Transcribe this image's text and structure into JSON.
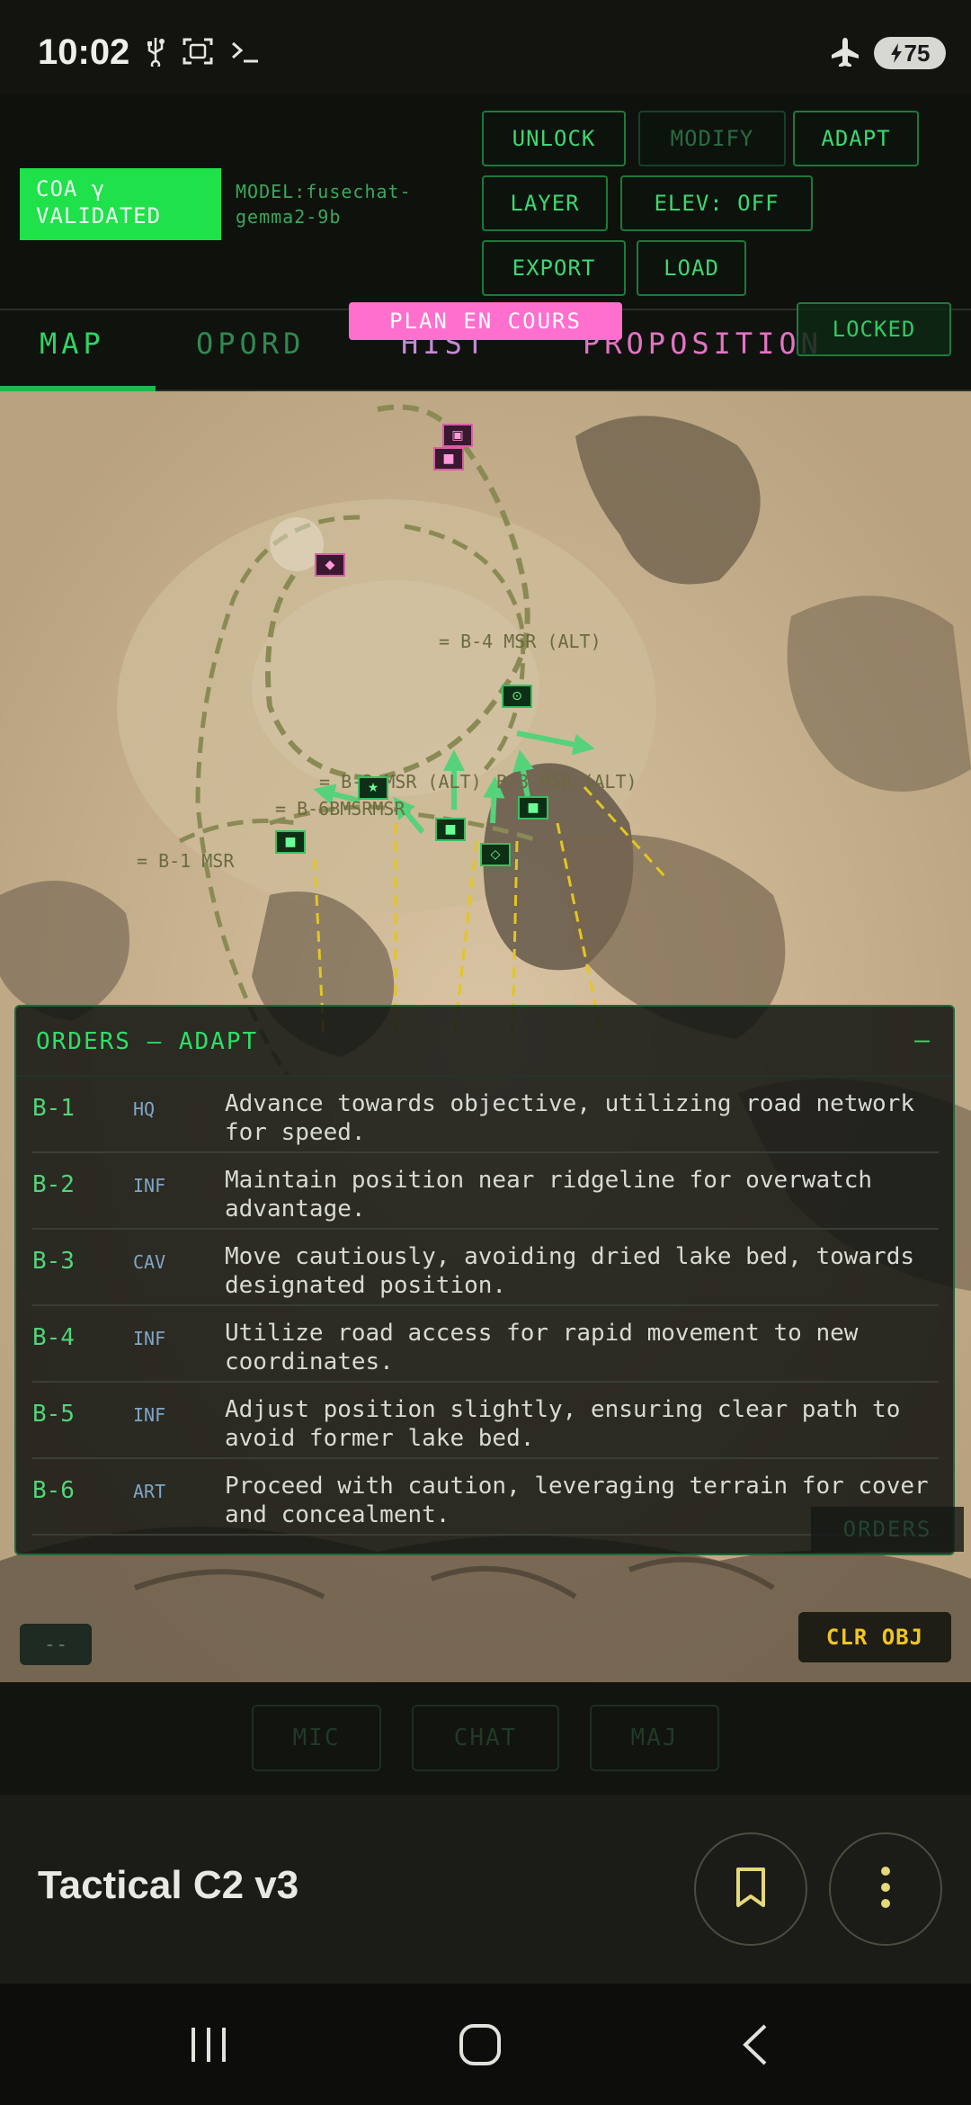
{
  "status_bar": {
    "time": "10:02",
    "battery_level": "75",
    "icons": [
      "usb-icon",
      "screenshot-icon",
      "terminal-icon",
      "airplane-mode-icon",
      "battery-charging-icon"
    ]
  },
  "header": {
    "coa_badge_line1": "COA γ",
    "coa_badge_line2": "VALIDATED",
    "model_line1": "MODEL:fusechat-",
    "model_line2": "gemma2-9b",
    "buttons": {
      "unlock": "UNLOCK",
      "modify": "MODIFY",
      "adapt": "ADAPT",
      "layer": "LAYER",
      "elev": "ELEV: OFF",
      "export": "EXPORT",
      "load": "LOAD"
    }
  },
  "tabs": {
    "map": "MAP",
    "opord": "OPORD",
    "hist": "HIST",
    "proposition": "PROPOSITION",
    "active": "MAP"
  },
  "overlay": {
    "plan_status": "PLAN EN COURS",
    "lock_status": "LOCKED"
  },
  "map": {
    "routes": [
      {
        "id": "b4",
        "label": "= B-4 MSR (ALT)"
      },
      {
        "id": "b2",
        "label": "= B-2 MSR (ALT)"
      },
      {
        "id": "b3",
        "label": "B-3 MSR (ALT)"
      },
      {
        "id": "b6",
        "label": "= B-6BMSRMSR"
      },
      {
        "id": "b1",
        "label": "= B-1 MSR"
      }
    ]
  },
  "orders": {
    "title": "ORDERS — ADAPT",
    "collapse_label": "—",
    "items": [
      {
        "id": "B-1",
        "type": "HQ",
        "text": "Advance towards objective, utilizing road network for speed."
      },
      {
        "id": "B-2",
        "type": "INF",
        "text": "Maintain position near ridgeline for overwatch advantage."
      },
      {
        "id": "B-3",
        "type": "CAV",
        "text": "Move cautiously, avoiding dried lake bed, towards designated position."
      },
      {
        "id": "B-4",
        "type": "INF",
        "text": "Utilize road access for rapid movement to new coordinates."
      },
      {
        "id": "B-5",
        "type": "INF",
        "text": "Adjust position slightly, ensuring clear path to avoid former lake bed."
      },
      {
        "id": "B-6",
        "type": "ART",
        "text": "Proceed with caution, leveraging terrain for cover and concealment."
      }
    ],
    "tag": "ORDERS"
  },
  "map_controls": {
    "dash": "--",
    "clear_objective": "CLR OBJ"
  },
  "bottom_controls": {
    "mic": "MIC",
    "chat": "CHAT",
    "maj": "MAJ"
  },
  "app_bar": {
    "title": "Tactical C2 v3"
  },
  "colors": {
    "accent_green": "#1fe14a",
    "status_pink": "#ff6fce",
    "warning_yellow": "#f0c524",
    "panel_border": "#1f6a38"
  }
}
